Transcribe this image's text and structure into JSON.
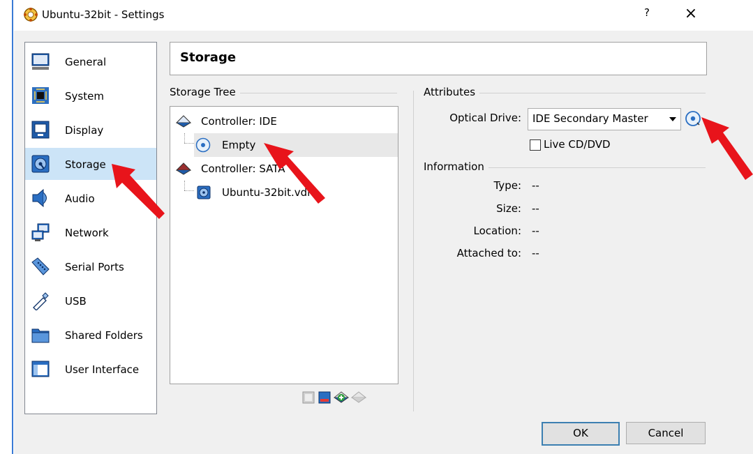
{
  "window": {
    "title": "Ubuntu-32bit - Settings",
    "help_label": "?",
    "close_label": "×"
  },
  "nav": {
    "items": [
      {
        "label": "General",
        "icon": "general-icon"
      },
      {
        "label": "System",
        "icon": "system-icon"
      },
      {
        "label": "Display",
        "icon": "display-icon"
      },
      {
        "label": "Storage",
        "icon": "storage-icon",
        "selected": true
      },
      {
        "label": "Audio",
        "icon": "audio-icon"
      },
      {
        "label": "Network",
        "icon": "network-icon"
      },
      {
        "label": "Serial Ports",
        "icon": "serial-ports-icon"
      },
      {
        "label": "USB",
        "icon": "usb-icon"
      },
      {
        "label": "Shared Folders",
        "icon": "shared-folders-icon"
      },
      {
        "label": "User Interface",
        "icon": "user-interface-icon"
      }
    ]
  },
  "page_title": "Storage",
  "storage_tree": {
    "label": "Storage Tree",
    "items": [
      {
        "label": "Controller: IDE",
        "type": "controller"
      },
      {
        "label": "Empty",
        "type": "optical",
        "selected": true
      },
      {
        "label": "Controller: SATA",
        "type": "controller"
      },
      {
        "label": "Ubuntu-32bit.vdi",
        "type": "disk"
      }
    ]
  },
  "attributes": {
    "label": "Attributes",
    "optical_drive_label": "Optical Drive:",
    "optical_drive_value": "IDE Secondary Master",
    "live_cd_label": "Live CD/DVD",
    "live_cd_checked": false
  },
  "information": {
    "label": "Information",
    "rows": [
      {
        "key": "Type:",
        "value": "--"
      },
      {
        "key": "Size:",
        "value": "--"
      },
      {
        "key": "Location:",
        "value": "--"
      },
      {
        "key": "Attached to:",
        "value": "--"
      }
    ]
  },
  "buttons": {
    "ok": "OK",
    "cancel": "Cancel"
  },
  "colors": {
    "selection": "#cce4f7",
    "accent": "#3c7fb1",
    "annotation_arrow": "#e8141b"
  }
}
